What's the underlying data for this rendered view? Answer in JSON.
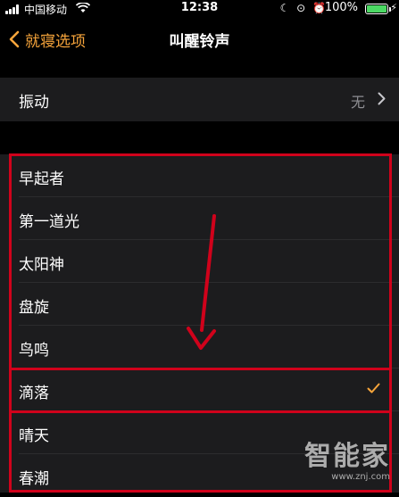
{
  "status_bar": {
    "carrier": "中国移动",
    "time": "12:38",
    "battery": "100%",
    "icons": [
      "moon-icon",
      "orientation-lock-icon",
      "alarm-icon",
      "charging-icon"
    ]
  },
  "nav": {
    "back_label": "就寝选项",
    "title": "叫醒铃声"
  },
  "vibration": {
    "label": "振动",
    "value": "无"
  },
  "ringtones": [
    {
      "label": "早起者",
      "selected": false
    },
    {
      "label": "第一道光",
      "selected": false
    },
    {
      "label": "太阳神",
      "selected": false
    },
    {
      "label": "盘旋",
      "selected": false
    },
    {
      "label": "鸟鸣",
      "selected": false
    },
    {
      "label": "滴落",
      "selected": true
    },
    {
      "label": "晴天",
      "selected": false
    },
    {
      "label": "春潮",
      "selected": false
    }
  ],
  "watermark": {
    "text": "智能家",
    "url": "www.znj.com"
  },
  "colors": {
    "accent": "#f7a53b",
    "annotation": "#d0021b",
    "cell_bg": "#1c1c1e"
  }
}
